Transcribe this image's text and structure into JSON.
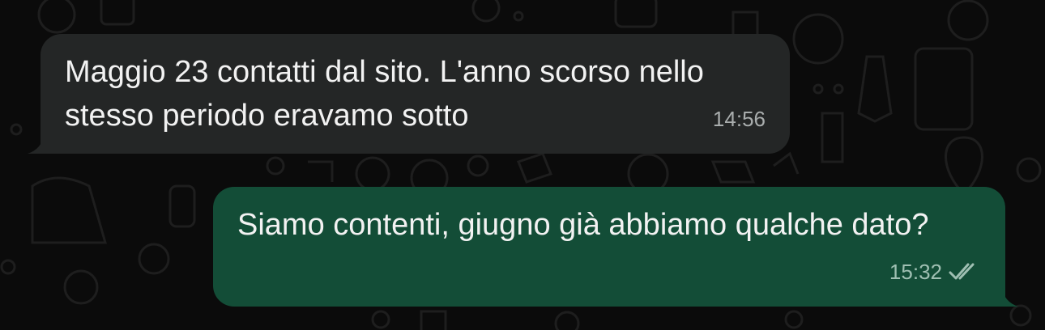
{
  "messages": [
    {
      "direction": "incoming",
      "text": "Maggio 23 contatti dal sito. L'anno scorso nello stesso periodo eravamo sotto",
      "time": "14:56"
    },
    {
      "direction": "outgoing",
      "text": "Siamo contenti, giugno già abbiamo qualche dato?",
      "time": "15:32",
      "status_icon": "double-check-icon"
    }
  ],
  "colors": {
    "background": "#0b0b0b",
    "incoming_bubble": "#242626",
    "outgoing_bubble": "#134d37",
    "text": "#f2f2f2",
    "meta_text": "#a9adad"
  }
}
